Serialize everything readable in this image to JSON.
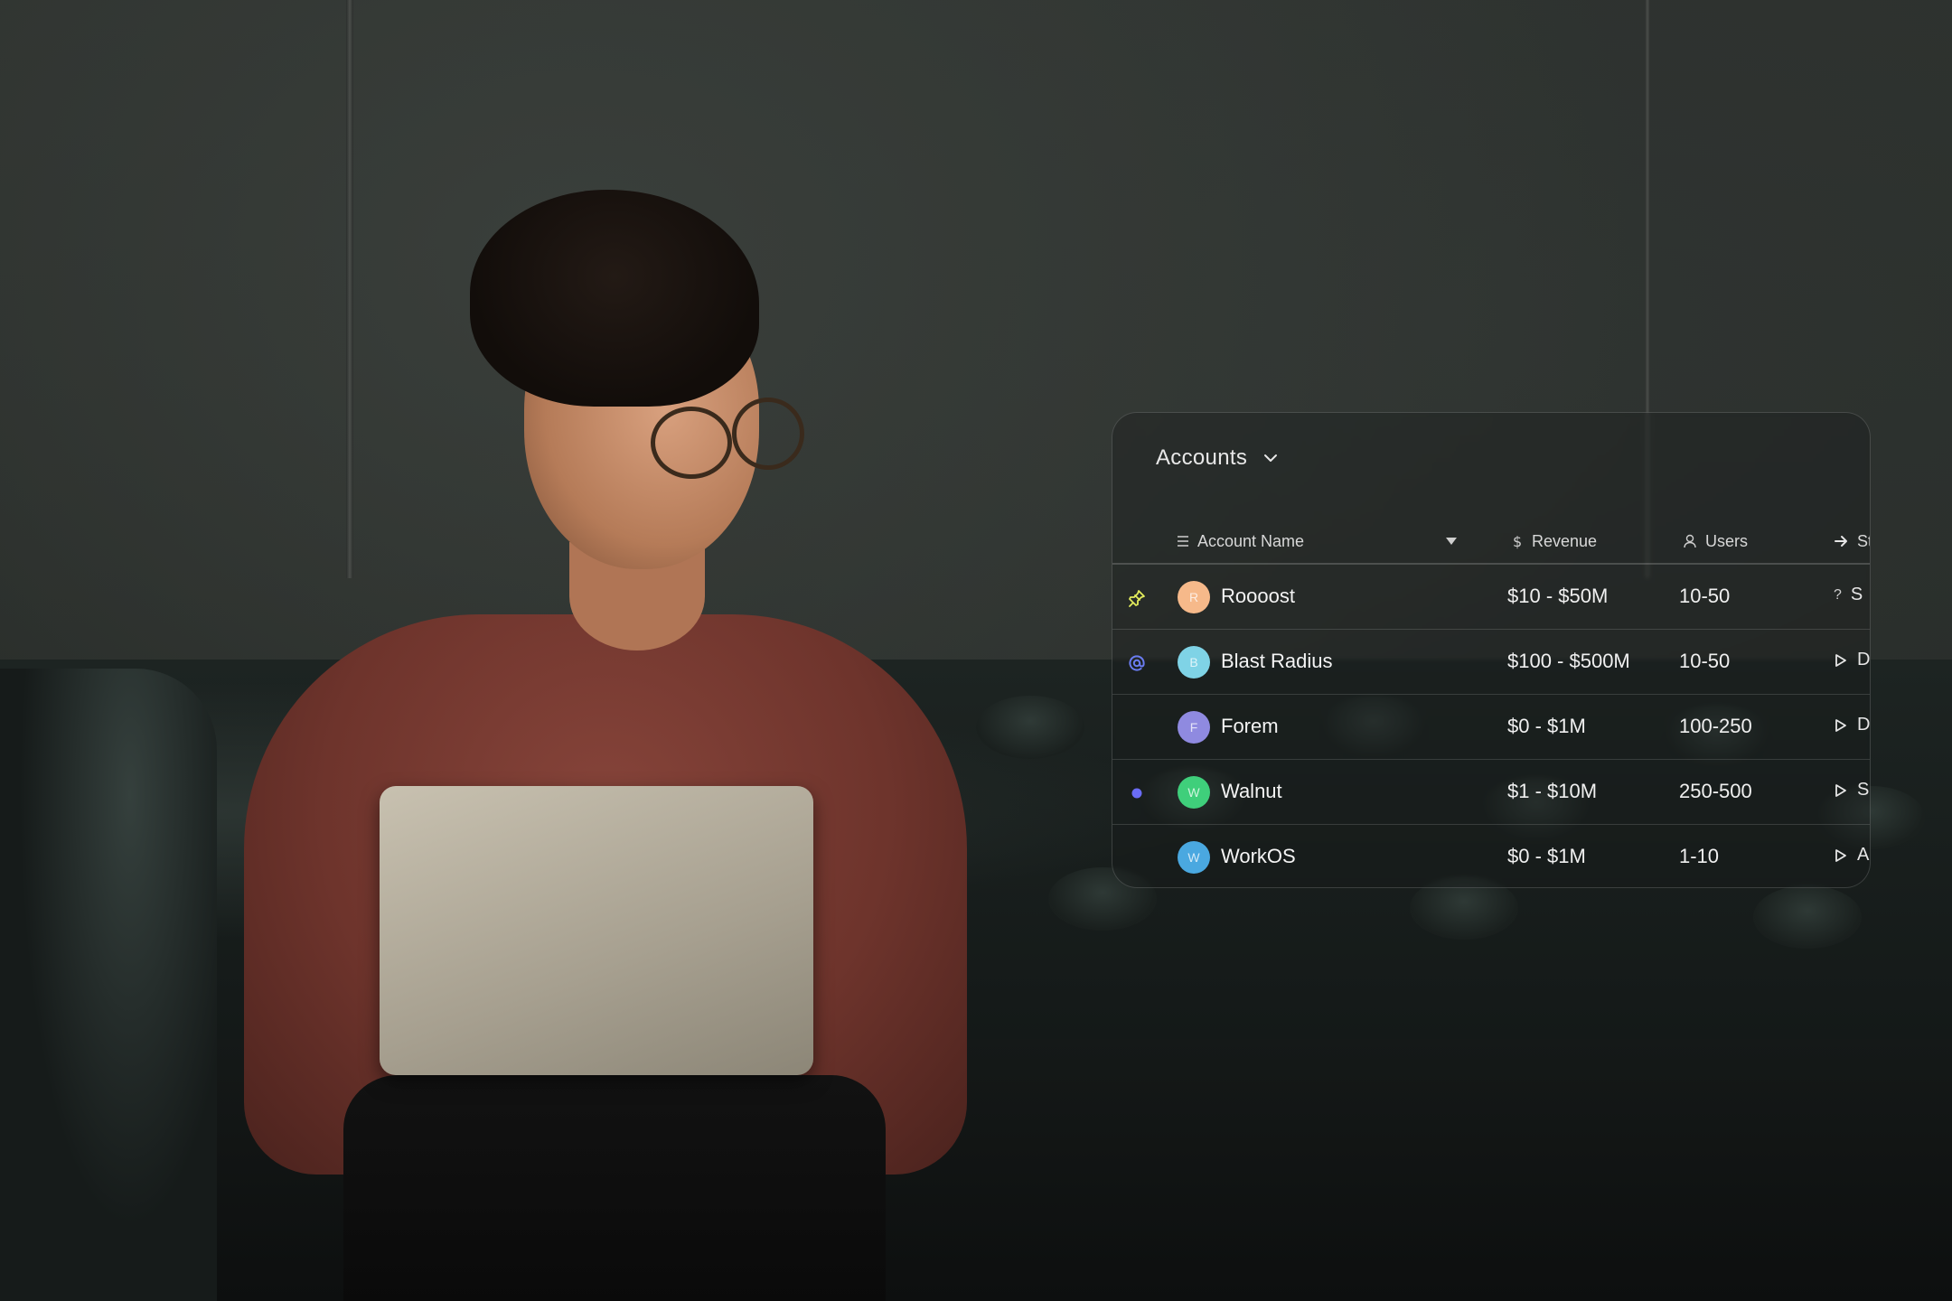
{
  "panel": {
    "title": "Accounts",
    "columns": [
      {
        "label": "Account Name",
        "icon": "list-icon"
      },
      {
        "label": "Revenue",
        "icon": "dollar-icon"
      },
      {
        "label": "Users",
        "icon": "user-icon"
      },
      {
        "label": "St",
        "icon": "arrow-right-icon"
      }
    ],
    "rows": [
      {
        "marker": "pin-icon",
        "avatar": "R",
        "avatar_color": "#f6b98a",
        "name": "Roooost",
        "revenue": "$10 - $50M",
        "users": "10-50",
        "status_icon": "question-icon",
        "status": "S"
      },
      {
        "marker": "at-icon",
        "avatar": "B",
        "avatar_color": "#7fd3e6",
        "name": "Blast Radius",
        "revenue": "$100 - $500M",
        "users": "10-50",
        "status_icon": "play-icon",
        "status": "D"
      },
      {
        "marker": "",
        "avatar": "F",
        "avatar_color": "#8f8ae0",
        "name": "Forem",
        "revenue": "$0 - $1M",
        "users": "100-250",
        "status_icon": "play-icon",
        "status": "D"
      },
      {
        "marker": "dot-icon",
        "avatar": "W",
        "avatar_color": "#3fcf7b",
        "name": "Walnut",
        "revenue": "$1 - $10M",
        "users": "250-500",
        "status_icon": "play-icon",
        "status": "S"
      },
      {
        "marker": "",
        "avatar": "W",
        "avatar_color": "#4aa8e0",
        "name": "WorkOS",
        "revenue": "$0 - $1M",
        "users": "1-10",
        "status_icon": "play-icon",
        "status": "A"
      }
    ]
  },
  "colors": {
    "pin": "#e3ec5c",
    "at": "#6a7cf0",
    "dot": "#6a6cf5"
  }
}
